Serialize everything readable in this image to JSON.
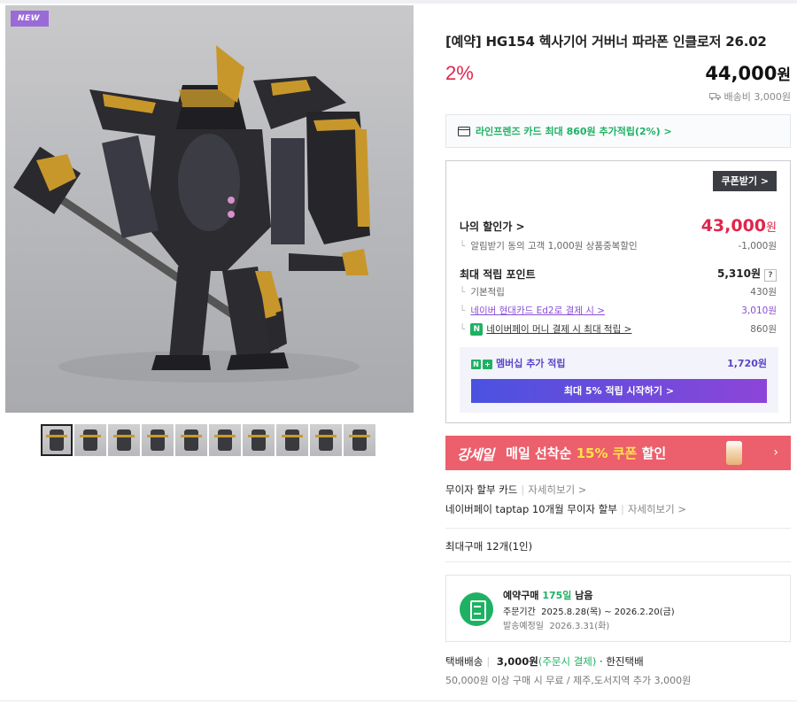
{
  "product": {
    "badge": "NEW",
    "title": "[예약] HG154 헥사기어 거버너 파라폰 인클로저 26.02",
    "discount_rate": "2%",
    "price": "44,000",
    "price_unit": "원",
    "shipping_fee": "배송비 3,000원",
    "thumbnail_count": 10
  },
  "card_promo": {
    "text": "라인프렌즈 카드 최대 860원 추가적립(2%) >"
  },
  "benefits": {
    "coupon_button": "쿠폰받기 >",
    "my_price_label": "나의 할인가 >",
    "my_price": "43,000",
    "my_price_unit": "원",
    "coupon_note": "알림받기 동의 고객 1,000원 상품중복할인",
    "coupon_amount": "-1,000원",
    "points_label": "최대 적립 포인트",
    "points_total": "5,310원",
    "points_help": "?",
    "basic_label": "기본적립",
    "basic_value": "430원",
    "card_label": "네이버 현대카드 Ed2로 결제 시 >",
    "card_value": "3,010원",
    "npay_label": "네이버페이 머니 결제 시 최대 적립 >",
    "npay_value": "860원",
    "membership_label": "멤버십 추가 적립",
    "membership_value": "1,720원",
    "membership_button": "최대 5% 적립 시작하기 >"
  },
  "banner": {
    "logo": "강세일",
    "text_before": "매일 선착순 ",
    "text_highlight": "15% 쿠폰",
    "text_after": " 할인",
    "colors": {
      "background": "#ec5f6c",
      "highlight": "#ffe24a"
    }
  },
  "installment": {
    "card_label": "무이자 할부 카드",
    "card_more": "자세히보기 >",
    "npay_label": "네이버페이 taptap 10개월 무이자 할부",
    "npay_more": "자세히보기 >"
  },
  "max_purchase": "최대구매 12개(1인)",
  "preorder": {
    "title_prefix": "예약구매 ",
    "days": "175일",
    "title_suffix": " 남음",
    "order_period_label": "주문기간",
    "order_period": "2025.8.28(목) ~ 2026.2.20(금)",
    "ship_date_label": "발송예정일",
    "ship_date": "2026.3.31(화)"
  },
  "delivery": {
    "label": "택배배송",
    "fee": "3,000원",
    "fee_note": "(주문시 결제)",
    "carrier": "· 한진택배",
    "free_note": "50,000원 이상 구매 시 무료 / 제주,도서지역 추가 3,000원"
  },
  "colors": {
    "accent_red": "#e0264b",
    "naver_green": "#1fb163",
    "purple": "#8a4ed6"
  }
}
